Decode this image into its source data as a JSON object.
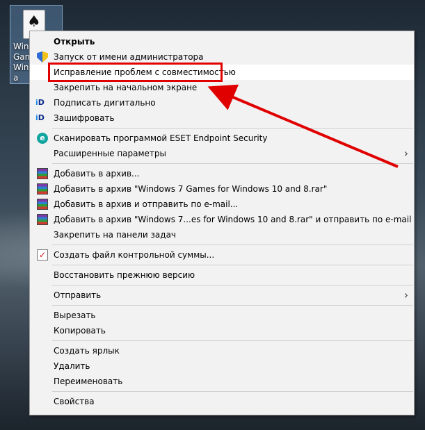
{
  "desktop": {
    "icon_label_lines": [
      "Win",
      "Gam",
      "Wind",
      "a"
    ]
  },
  "menu": {
    "open": "Открыть",
    "run_as_admin": "Запуск от имени администратора",
    "troubleshoot": "Исправление проблем с совместимостью",
    "pin_start": "Закрепить на начальном экране",
    "sign_digitally": "Подписать дигитально",
    "encrypt": "Зашифровать",
    "eset_scan": "Сканировать программой ESET Endpoint Security",
    "advanced": "Расширенные параметры",
    "add_archive": "Добавить в архив...",
    "add_named_archive": "Добавить в архив \"Windows 7 Games for Windows 10 and 8.rar\"",
    "add_archive_email": "Добавить в архив и отправить по e-mail...",
    "add_named_archive_email": "Добавить в архив \"Windows 7...es for Windows 10 and 8.rar\" и отправить по e-mail",
    "pin_taskbar": "Закрепить на панели задач",
    "checksum": "Создать файл контрольной суммы...",
    "restore": "Восстановить прежнюю версию",
    "send_to": "Отправить",
    "cut": "Вырезать",
    "copy": "Копировать",
    "create_shortcut": "Создать ярлык",
    "delete": "Удалить",
    "rename": "Переименовать",
    "properties": "Свойства"
  },
  "icons": {
    "id_prefix": "i",
    "id_suffix": "D",
    "eset_letter": "e",
    "check_mark": "✓",
    "submenu_arrow": "›",
    "spade": "♠"
  },
  "colors": {
    "annotation": "#e00000"
  }
}
